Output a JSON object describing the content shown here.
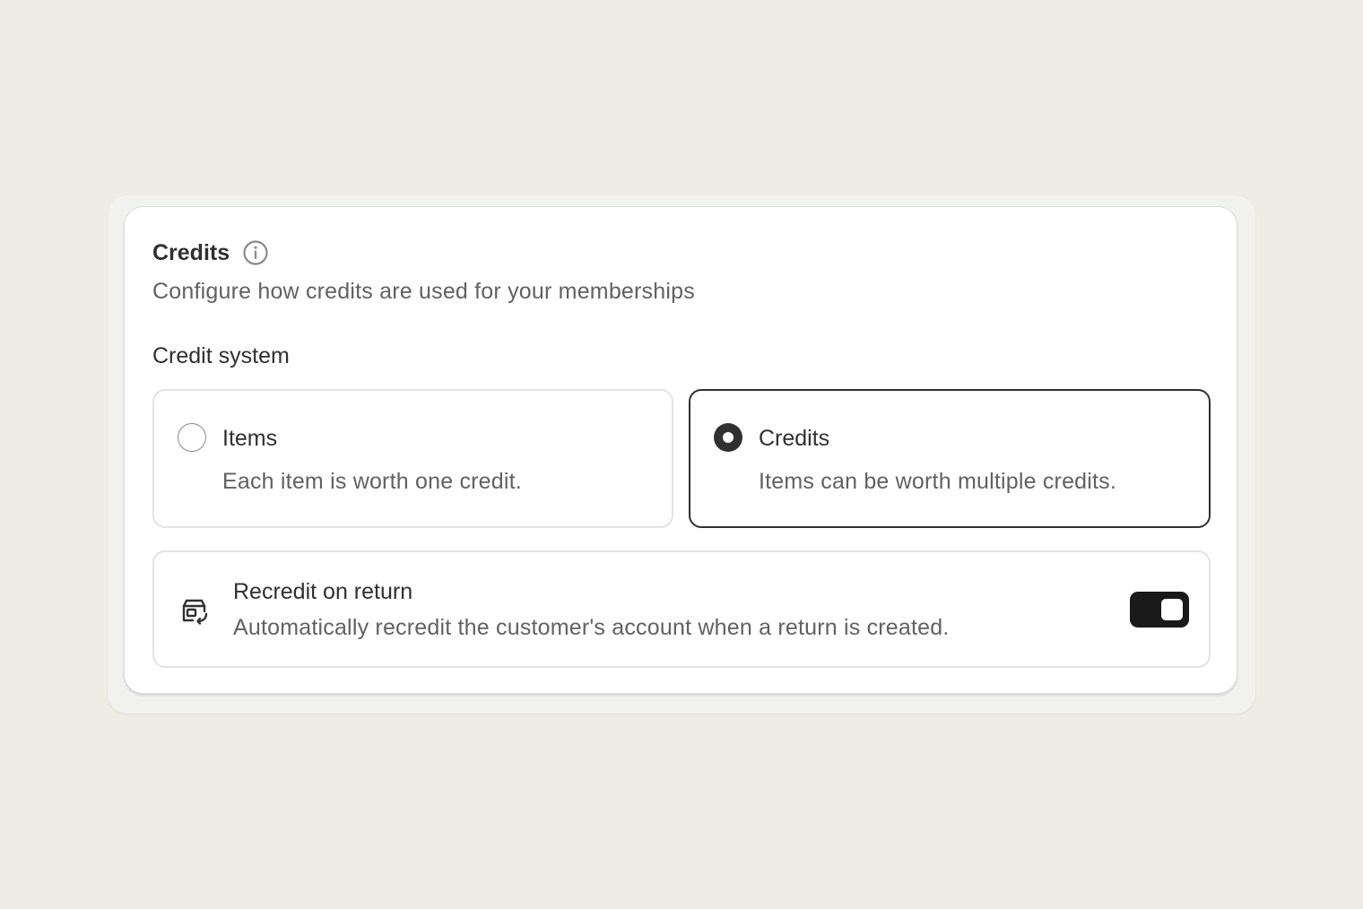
{
  "credits": {
    "title": "Credits",
    "subtitle": "Configure how credits are used for your memberships",
    "info_icon": "info-circle-icon"
  },
  "credit_system": {
    "label": "Credit system",
    "selected": "credits",
    "options": [
      {
        "id": "items",
        "label": "Items",
        "description": "Each item is worth one credit.",
        "selected": false
      },
      {
        "id": "credits",
        "label": "Credits",
        "description": "Items can be worth multiple credits.",
        "selected": true
      }
    ]
  },
  "recredit": {
    "title": "Recredit on return",
    "description": "Automatically recredit the customer's account when a return is created.",
    "icon": "return-box-icon",
    "enabled": true
  },
  "colors": {
    "background": "#edece5",
    "card": "#ffffff",
    "selected_border": "#303030",
    "toggle_on": "#1a1a1a",
    "muted_text": "#616161"
  }
}
